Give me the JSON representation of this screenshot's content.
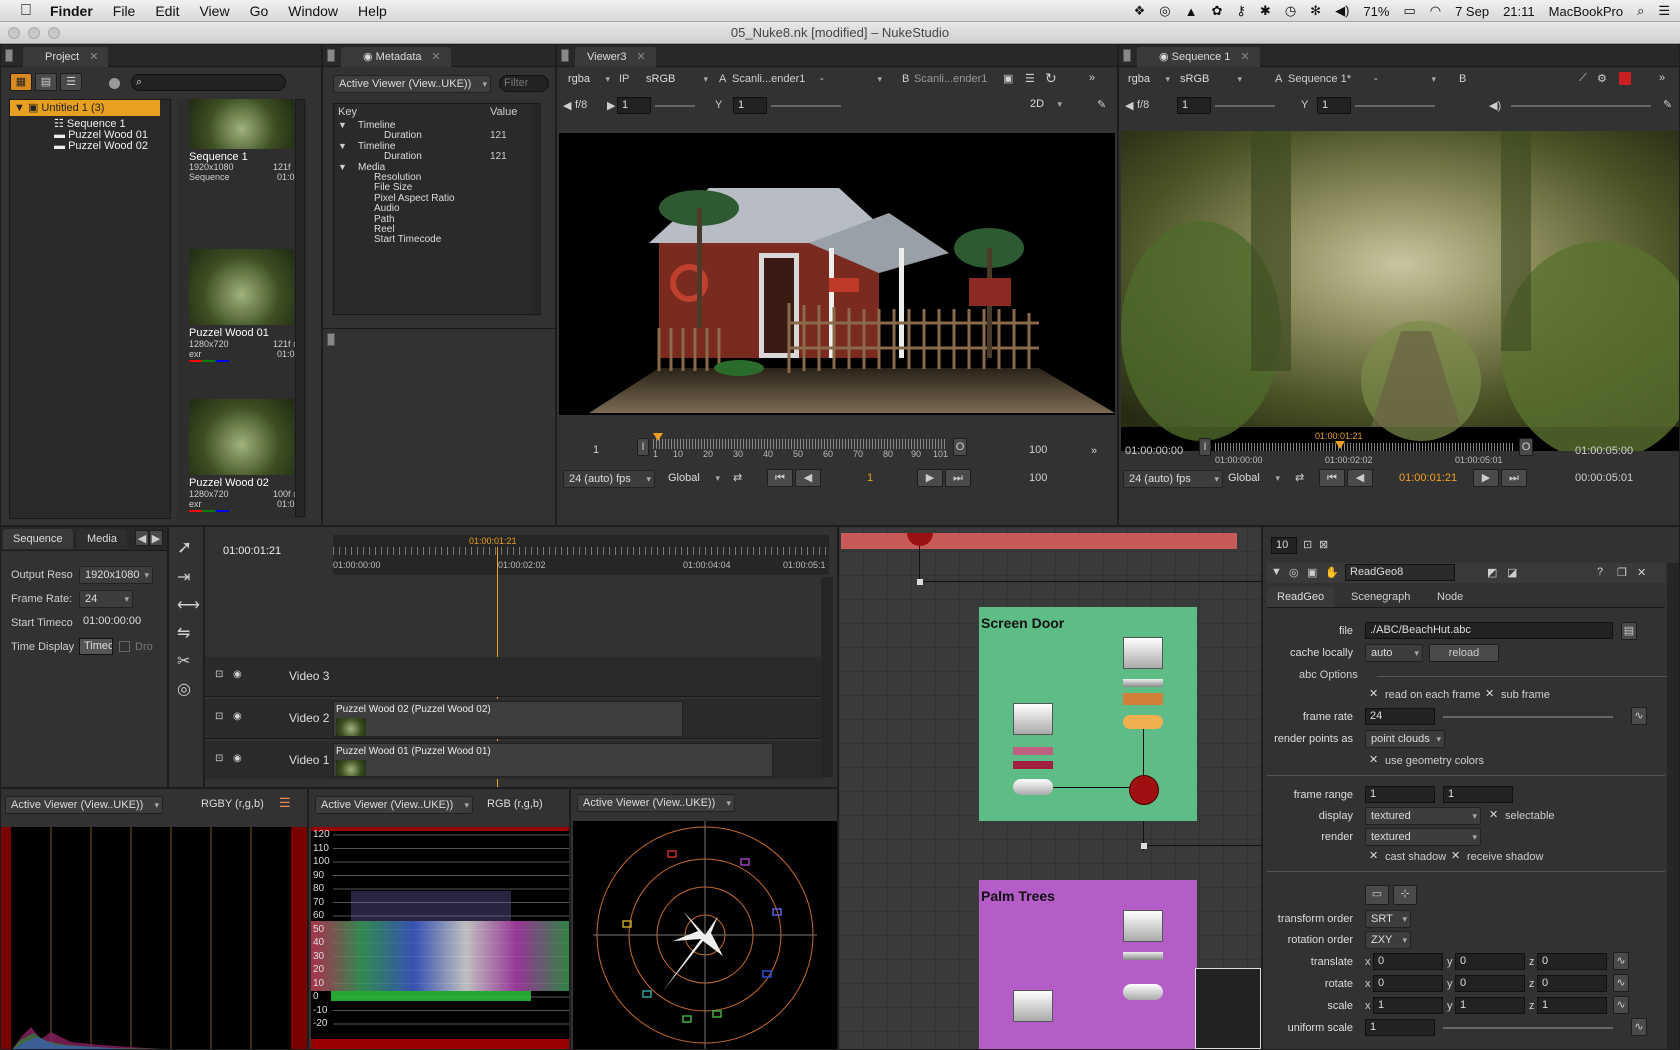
{
  "menubar": {
    "app": "Finder",
    "items": [
      "File",
      "Edit",
      "View",
      "Go",
      "Window",
      "Help"
    ],
    "battery": "71%",
    "date": "7 Sep",
    "time": "21:11",
    "computer": "MacBookPro"
  },
  "window": {
    "title": "05_Nuke8.nk [modified] – NukeStudio"
  },
  "project": {
    "tab": "Project",
    "root": "Untitled 1 (3)",
    "items": [
      "Sequence 1",
      "Puzzel Wood 01",
      "Puzzel Wood 02"
    ],
    "bins": [
      {
        "name": "Sequence 1",
        "res": "1920x1080",
        "kind": "Sequence",
        "frames": "121f",
        "tc": "01:0"
      },
      {
        "name": "Puzzel Wood 01",
        "res": "1280x720",
        "kind": "exr",
        "frames": "121f @",
        "tc": "01:0"
      },
      {
        "name": "Puzzel Wood 02",
        "res": "1280x720",
        "kind": "exr",
        "frames": "100f @",
        "tc": "01:0"
      }
    ]
  },
  "metadata": {
    "tab": "Metadata",
    "viewer": "Active Viewer (View..UKE))",
    "filter": "Filter",
    "col_key": "Key",
    "col_value": "Value",
    "rows": [
      {
        "k": "Timeline",
        "v": "",
        "level": 0
      },
      {
        "k": "Duration",
        "v": "121",
        "level": 1
      },
      {
        "k": "Timeline",
        "v": "",
        "level": 0
      },
      {
        "k": "Duration",
        "v": "121",
        "level": 1
      },
      {
        "k": "Media",
        "v": "",
        "level": 0
      },
      {
        "k": "Resolution",
        "v": "",
        "level": 2
      },
      {
        "k": "File Size",
        "v": "",
        "level": 2
      },
      {
        "k": "Pixel Aspect Ratio",
        "v": "",
        "level": 2
      },
      {
        "k": "Audio",
        "v": "",
        "level": 2
      },
      {
        "k": "Path",
        "v": "",
        "level": 2
      },
      {
        "k": "Reel",
        "v": "",
        "level": 2
      },
      {
        "k": "Start Timecode",
        "v": "",
        "level": 2
      }
    ]
  },
  "viewer3": {
    "tab": "Viewer3",
    "channels": "rgba",
    "ip": "IP",
    "lut": "sRGB",
    "a_label": "A",
    "a_input": "Scanli...ender1",
    "a_dash": "-",
    "b_label": "B",
    "b_input": "Scanli...ender1",
    "gain": "f/8",
    "gain_val": "1",
    "gamma_label": "Y",
    "gamma_val": "1",
    "mode": "2D",
    "frame_start": "1",
    "frame_end": "100",
    "cur_frame": "1",
    "fps": "24 (auto) fps",
    "scope": "Global",
    "ticks": [
      "1",
      "10",
      "20",
      "30",
      "40",
      "50",
      "60",
      "70",
      "80",
      "90",
      "101"
    ],
    "end2": "100",
    "in": "I",
    "out": "O"
  },
  "sequence1": {
    "tab": "Sequence 1",
    "channels": "rgba",
    "lut": "sRGB",
    "a_label": "A",
    "a_input": "Sequence 1*",
    "a_dash": "-",
    "b_label": "B",
    "gain": "f/8",
    "gain_val": "1",
    "gamma_label": "Y",
    "gamma_val": "1",
    "tc_start": "01:00:00:00",
    "tc_end": "01:00:05:00",
    "tc_cur": "01:00:01:21",
    "ticks": [
      "01:00:00:00",
      "01:00:02:02",
      "01:00:05:01"
    ],
    "fps": "24 (auto) fps",
    "scope": "Global",
    "cur_tc": "01:00:01:21",
    "duration": "00:00:05:01",
    "in": "I",
    "out": "O"
  },
  "seqpanel": {
    "tabs": [
      "Sequence",
      "Media"
    ],
    "fields": [
      {
        "l": "Output Reso",
        "v": "1920x1080"
      },
      {
        "l": "Frame Rate:",
        "v": "24"
      },
      {
        "l": "Start Timeco",
        "v": "01:00:00:00"
      },
      {
        "l": "Time Display",
        "v": "Timeco"
      }
    ],
    "drop": "Dro"
  },
  "timeline": {
    "cur": "01:00:01:21",
    "playhead": "01:00:01:21",
    "ticks": [
      "01:00:00:00",
      "01:00:02:02",
      "01:00:04:04",
      "01:00:05:1"
    ],
    "tracks": [
      {
        "name": "Video 3",
        "clip": ""
      },
      {
        "name": "Video 2",
        "clip": "Puzzel Wood 02 (Puzzel Wood 02)"
      },
      {
        "name": "Video 1",
        "clip": "Puzzel Wood 01 (Puzzel Wood 01)"
      }
    ]
  },
  "scopes": {
    "histogram": {
      "viewer": "Active Viewer (View..UKE))",
      "mode": "RGBY (r,g,b)"
    },
    "waveform": {
      "viewer": "Active Viewer (View..UKE))",
      "mode": "RGB (r,g,b)",
      "labels": [
        "120",
        "110",
        "100",
        "90",
        "80",
        "70",
        "60",
        "50",
        "40",
        "30",
        "20",
        "10",
        "0",
        "-10",
        "-20"
      ]
    },
    "vectorscope": {
      "viewer": "Active Viewer (View..UKE))"
    }
  },
  "nodegraph": {
    "backdrops": [
      {
        "name": "Screen Door",
        "color": "#5ebd87"
      },
      {
        "name": "Palm Trees",
        "color": "#b45cc7"
      }
    ]
  },
  "props": {
    "count": "10",
    "node": "ReadGeo8",
    "tabs": [
      "ReadGeo",
      "Scenegraph",
      "Node"
    ],
    "file": "./ABC/BeachHut.abc",
    "cache_locally": "auto",
    "reload": "reload",
    "abc_options": "abc Options",
    "read_each": "read on each frame",
    "sub_frame": "sub frame",
    "frame_rate": "24",
    "render_points": "point clouds",
    "use_geo_colors": "use geometry colors",
    "frame_range_a": "1",
    "frame_range_b": "1",
    "display": "textured",
    "selectable": "selectable",
    "render": "textured",
    "cast_shadow": "cast shadow",
    "receive_shadow": "receive shadow",
    "transform_order": "SRT",
    "rotation_order": "ZXY",
    "translate": [
      "0",
      "0",
      "0"
    ],
    "rotate": [
      "0",
      "0",
      "0"
    ],
    "scale": [
      "1",
      "1",
      "1"
    ],
    "uniform_scale": "1",
    "labels": {
      "file": "file",
      "cache": "cache locally",
      "frame_rate": "frame rate",
      "render_points": "render points as",
      "frame_range": "frame range",
      "display": "display",
      "render": "render",
      "transform_order": "transform order",
      "rotation_order": "rotation order",
      "translate": "translate",
      "rotate": "rotate",
      "scale": "scale",
      "uniform_scale": "uniform scale"
    },
    "axes": [
      "x",
      "y",
      "z"
    ]
  },
  "colors": {
    "accent": "#f0a020",
    "selected": "#e8a020",
    "screen_door": "#5ebd87",
    "palm_trees": "#b45cc7",
    "red_bar": "#c85a5a"
  }
}
